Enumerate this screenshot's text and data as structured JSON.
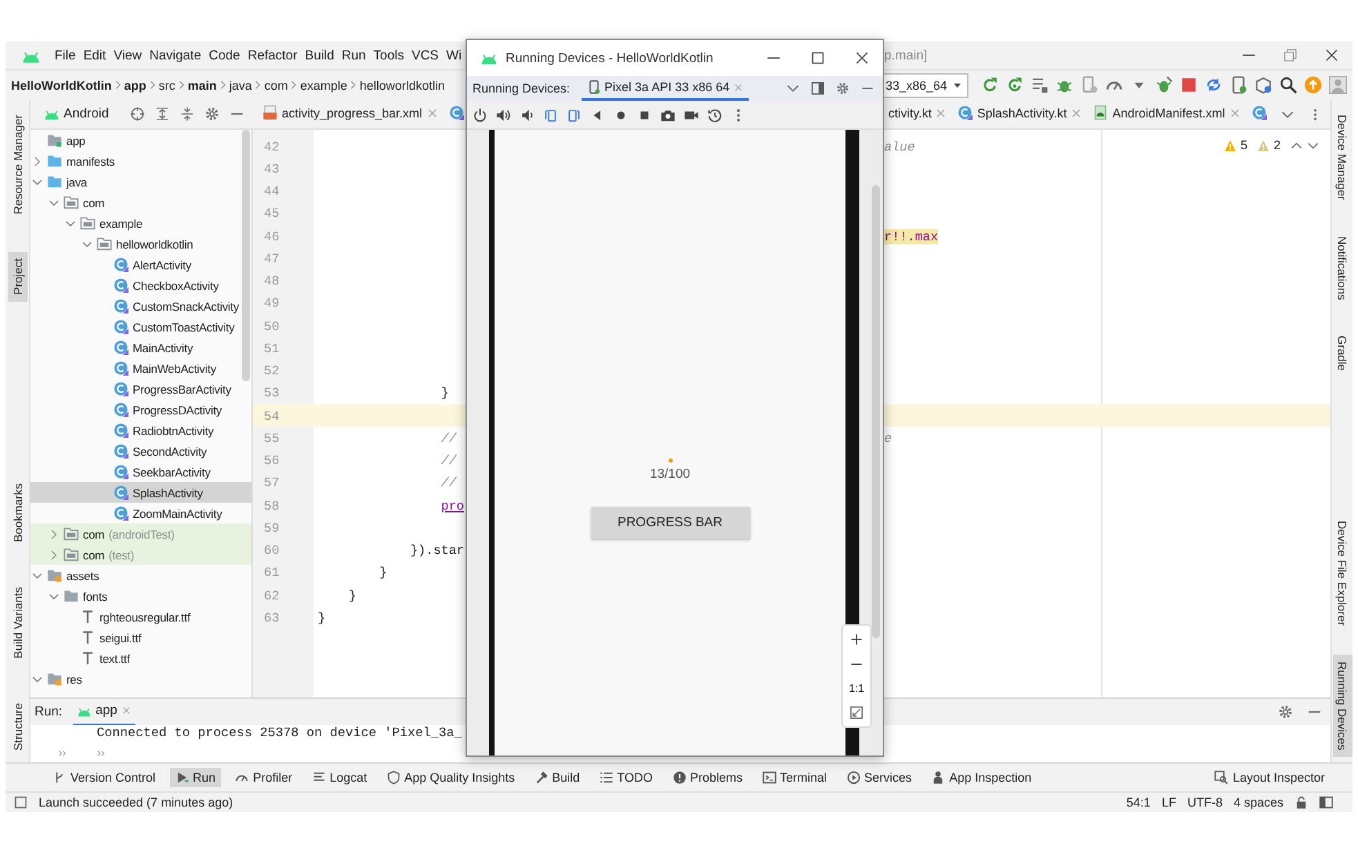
{
  "menu_bar": {
    "items": [
      "File",
      "Edit",
      "View",
      "Navigate",
      "Code",
      "Refactor",
      "Build",
      "Run",
      "Tools",
      "VCS",
      "Wi"
    ],
    "title_fragment": "p.main]"
  },
  "nav_bar": {
    "breadcrumbs": [
      {
        "label": "HelloWorldKotlin",
        "bold": true
      },
      {
        "label": "app",
        "bold": true
      },
      {
        "label": "src",
        "bold": false
      },
      {
        "label": "main",
        "bold": true
      },
      {
        "label": "java",
        "bold": false
      },
      {
        "label": "com",
        "bold": false
      },
      {
        "label": "example",
        "bold": false
      },
      {
        "label": "helloworldkotlin",
        "bold": false
      }
    ],
    "device_selector": "33_x86_64"
  },
  "left_strip": {
    "top": [
      {
        "label": "Resource Manager",
        "selected": false
      },
      {
        "label": "Project",
        "selected": true
      }
    ],
    "bottom": [
      {
        "label": "Bookmarks",
        "selected": false
      },
      {
        "label": "Build Variants",
        "selected": false
      },
      {
        "label": "Structure",
        "selected": false
      }
    ]
  },
  "project_panel": {
    "view": "Android",
    "tree": [
      {
        "label": "app",
        "kind": "module",
        "selected": false,
        "children": [
          {
            "label": "manifests",
            "kind": "source-folder",
            "expanded": false,
            "selected": false
          },
          {
            "label": "java",
            "kind": "source-folder",
            "expanded": true,
            "selected": false,
            "children": [
              {
                "label": "com",
                "kind": "package",
                "expanded": true,
                "selected": false,
                "children": [
                  {
                    "label": "example",
                    "kind": "package",
                    "expanded": true,
                    "selected": false,
                    "children": [
                      {
                        "label": "helloworldkotlin",
                        "kind": "package",
                        "expanded": true,
                        "selected": false,
                        "children": [
                          {
                            "label": "AlertActivity",
                            "kind": "class",
                            "selected": false
                          },
                          {
                            "label": "CheckboxActivity",
                            "kind": "class",
                            "selected": false
                          },
                          {
                            "label": "CustomSnackActivity",
                            "kind": "class",
                            "selected": false
                          },
                          {
                            "label": "CustomToastActivity",
                            "kind": "class",
                            "selected": false
                          },
                          {
                            "label": "MainActivity",
                            "kind": "class",
                            "selected": false
                          },
                          {
                            "label": "MainWebActivity",
                            "kind": "class",
                            "selected": false
                          },
                          {
                            "label": "ProgressBarActivity",
                            "kind": "class",
                            "selected": false
                          },
                          {
                            "label": "ProgressDActivity",
                            "kind": "class",
                            "selected": false
                          },
                          {
                            "label": "RadiobtnActivity",
                            "kind": "class",
                            "selected": false
                          },
                          {
                            "label": "SecondActivity",
                            "kind": "class",
                            "selected": false
                          },
                          {
                            "label": "SeekbarActivity",
                            "kind": "class",
                            "selected": false
                          },
                          {
                            "label": "SplashActivity",
                            "kind": "class",
                            "selected": true
                          },
                          {
                            "label": "ZoomMainActivity",
                            "kind": "class",
                            "selected": false
                          }
                        ]
                      }
                    ]
                  }
                ]
              },
              {
                "label": "com",
                "note": "(androidTest)",
                "kind": "test-package",
                "expanded": false,
                "selected": false
              },
              {
                "label": "com",
                "note": "(test)",
                "kind": "test-package",
                "expanded": false,
                "selected": false
              }
            ]
          },
          {
            "label": "assets",
            "kind": "resource-folder",
            "expanded": true,
            "selected": false,
            "children": [
              {
                "label": "fonts",
                "kind": "folder",
                "expanded": true,
                "selected": false,
                "children": [
                  {
                    "label": "rghteousregular.ttf",
                    "kind": "font-file",
                    "selected": false
                  },
                  {
                    "label": "seigui.ttf",
                    "kind": "font-file",
                    "selected": false
                  },
                  {
                    "label": "text.ttf",
                    "kind": "font-file",
                    "selected": false
                  }
                ]
              }
            ]
          },
          {
            "label": "res",
            "kind": "resource-folder",
            "expanded": true,
            "selected": false
          }
        ]
      }
    ]
  },
  "editor": {
    "tabs_left": [
      {
        "kind": "xml",
        "label": "activity_progress_bar.xml",
        "selected": false
      },
      {
        "kind": "kotlin",
        "selected": false
      }
    ],
    "tabs_right": [
      {
        "kind": "none",
        "label": "ctivity.kt",
        "selected": false
      },
      {
        "kind": "kotlin",
        "label": "SplashActivity.kt",
        "selected": false
      },
      {
        "kind": "manifest",
        "label": "AndroidManifest.xml",
        "selected": false
      },
      {
        "kind": "kotlin",
        "selected": false
      }
    ],
    "warnings": "5",
    "weak_warnings": "2",
    "lines": [
      {
        "number": "42",
        "current": false,
        "right": {
          "text": "alue",
          "kind": "comment"
        }
      },
      {
        "number": "43",
        "current": false
      },
      {
        "number": "44",
        "current": false
      },
      {
        "number": "45",
        "current": false
      },
      {
        "number": "46",
        "current": false,
        "right": {
          "text": "r!!.max",
          "kind": "highlight"
        }
      },
      {
        "number": "47",
        "current": false
      },
      {
        "number": "48",
        "current": false
      },
      {
        "number": "49",
        "current": false
      },
      {
        "number": "50",
        "current": false
      },
      {
        "number": "51",
        "current": false
      },
      {
        "number": "52",
        "current": false
      },
      {
        "number": "53",
        "current": false,
        "left": {
          "text": "                }",
          "kind": "code"
        }
      },
      {
        "number": "54",
        "current": true
      },
      {
        "number": "55",
        "current": false,
        "left": {
          "text": "                //",
          "kind": "comment"
        },
        "right": {
          "text": "e",
          "kind": "comment"
        }
      },
      {
        "number": "56",
        "current": false,
        "left": {
          "text": "                //",
          "kind": "comment"
        }
      },
      {
        "number": "57",
        "current": false,
        "left": {
          "text": "                //",
          "kind": "comment"
        }
      },
      {
        "number": "58",
        "current": false,
        "left": {
          "text": "                pro",
          "kind": "property"
        }
      },
      {
        "number": "59",
        "current": false
      },
      {
        "number": "60",
        "current": false,
        "left": {
          "text": "            }).star",
          "kind": "code"
        }
      },
      {
        "number": "61",
        "current": false,
        "left": {
          "text": "        }",
          "kind": "code"
        }
      },
      {
        "number": "62",
        "current": false,
        "left": {
          "text": "    }",
          "kind": "code"
        }
      },
      {
        "number": "63",
        "current": false,
        "left": {
          "text": "}",
          "kind": "code"
        }
      }
    ]
  },
  "right_strip": {
    "top": [
      {
        "label": "Device Manager",
        "selected": false
      },
      {
        "label": "Notifications",
        "selected": false
      },
      {
        "label": "Gradle",
        "selected": false
      }
    ],
    "bottom": [
      {
        "label": "Device File Explorer",
        "selected": false
      },
      {
        "label": "Running Devices",
        "selected": true
      }
    ]
  },
  "run_panel": {
    "title": "Run:",
    "tab": {
      "label": "app",
      "selected": true
    },
    "console": "Connected to process 25378 on device 'Pixel_3a_"
  },
  "tool_windows": {
    "left": [
      {
        "label": "Version Control",
        "selected": false
      },
      {
        "label": "Run",
        "selected": true
      },
      {
        "label": "Profiler",
        "selected": false
      },
      {
        "label": "Logcat",
        "selected": false
      },
      {
        "label": "App Quality Insights",
        "selected": false
      },
      {
        "label": "Build",
        "selected": false
      },
      {
        "label": "TODO",
        "selected": false
      },
      {
        "label": "Problems",
        "selected": false
      },
      {
        "label": "Terminal",
        "selected": false
      },
      {
        "label": "Services",
        "selected": false
      },
      {
        "label": "App Inspection",
        "selected": false
      }
    ],
    "right": [
      {
        "label": "Layout Inspector",
        "selected": false
      }
    ]
  },
  "status_bar": {
    "message": "Launch succeeded (7 minutes ago)",
    "position": "54:1",
    "line_separator": "LF",
    "encoding": "UTF-8",
    "indent": "4 spaces"
  },
  "running_devices": {
    "title": "Running Devices - HelloWorldKotlin",
    "label": "Running Devices:",
    "tabs": [
      {
        "label": "Pixel 3a API 33 x86 64",
        "selected": true
      }
    ],
    "progress_text": "13/100",
    "button": "PROGRESS BAR",
    "zoom_reset": "1:1"
  }
}
